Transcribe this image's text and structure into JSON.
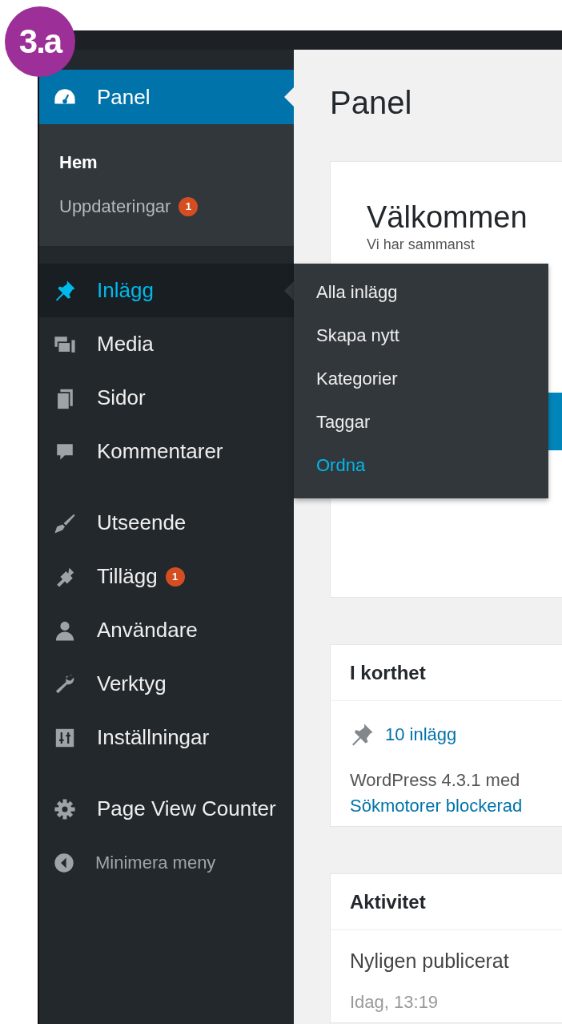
{
  "step_badge": "3.a",
  "menu": {
    "groups": [
      {
        "items": [
          {
            "label": "Panel",
            "selected": true,
            "open": false,
            "submenu": [
              {
                "label": "Hem",
                "selected": true
              },
              {
                "label": "Uppdateringar",
                "selected": false,
                "badge": "1"
              }
            ]
          }
        ]
      },
      {
        "items": [
          {
            "label": "Inlägg",
            "selected": false,
            "open": true,
            "flyout": [
              {
                "label": "Alla inlägg",
                "selected": false
              },
              {
                "label": "Skapa nytt",
                "selected": false
              },
              {
                "label": "Kategorier",
                "selected": false
              },
              {
                "label": "Taggar",
                "selected": false
              },
              {
                "label": "Ordna",
                "selected": true
              }
            ]
          },
          {
            "label": "Media",
            "selected": false,
            "open": false
          },
          {
            "label": "Sidor",
            "selected": false,
            "open": false
          },
          {
            "label": "Kommentarer",
            "selected": false,
            "open": false
          }
        ]
      },
      {
        "items": [
          {
            "label": "Utseende",
            "selected": false,
            "open": false
          },
          {
            "label": "Tillägg",
            "selected": false,
            "open": false,
            "badge": "1"
          },
          {
            "label": "Användare",
            "selected": false,
            "open": false
          },
          {
            "label": "Verktyg",
            "selected": false,
            "open": false
          },
          {
            "label": "Inställningar",
            "selected": false,
            "open": false
          }
        ]
      },
      {
        "items": [
          {
            "label": "Page View Counter",
            "selected": false,
            "open": false
          }
        ]
      }
    ],
    "collapse": "Minimera meny"
  },
  "page_title": "Panel",
  "welcome": {
    "title": "Välkommen",
    "subtitle": "Vi har sammanst"
  },
  "at_a_glance": {
    "title": "I korthet",
    "posts": "10 inlägg",
    "version": "WordPress 4.3.1 med",
    "search_engines": "Sökmotorer blockerad"
  },
  "activity": {
    "title": "Aktivitet",
    "heading": "Nyligen publicerat",
    "time": "Idag, 13:19"
  }
}
